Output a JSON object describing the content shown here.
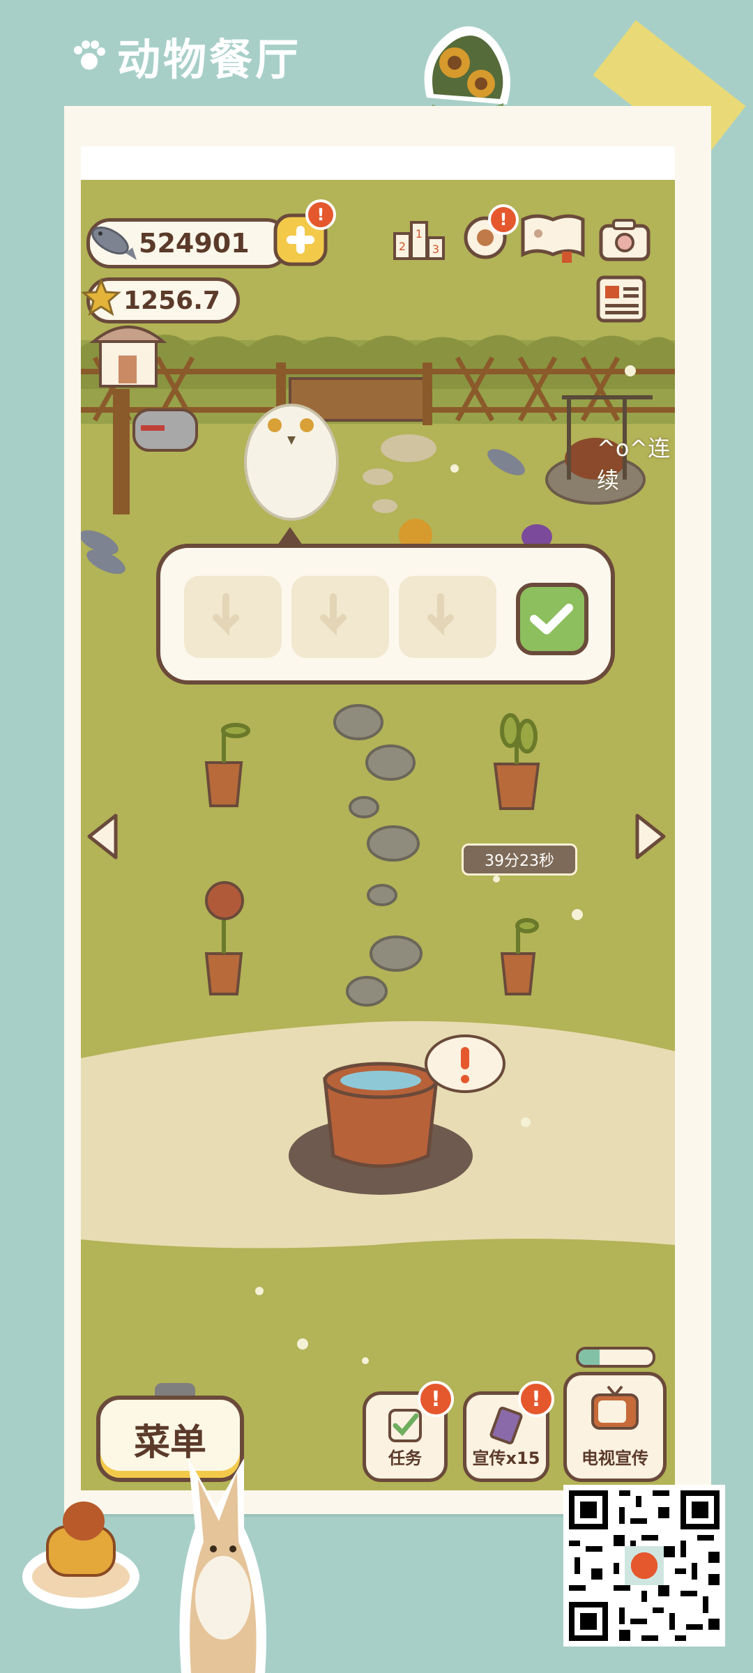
{
  "app": {
    "brand_title": "动物餐厅"
  },
  "currency": {
    "fish": "524901",
    "stars": "1256.7"
  },
  "top_icons": [
    "trophy-icon",
    "gear-icon",
    "guestbook-icon",
    "camera-icon",
    "newspaper-icon"
  ],
  "scene": {
    "streak_text": "^o^连续",
    "timer": "39分23秒"
  },
  "popup": {
    "slots": [
      "empty",
      "empty",
      "empty"
    ],
    "confirm_icon": "checkmark-icon"
  },
  "bottom_bar": {
    "menu_label": "菜单",
    "tasks_label": "任务",
    "promo_label": "宣传x15",
    "tv_label": "电视宣传",
    "tv_progress": 0.28
  },
  "colors": {
    "background": "#a7cfc8",
    "grass": "#b3b357",
    "path": "#e7dcb3",
    "outline": "#6a4a3a",
    "accent_yellow": "#f3c94a",
    "alert_red": "#e5582e",
    "confirm_green": "#8dbf5e"
  }
}
